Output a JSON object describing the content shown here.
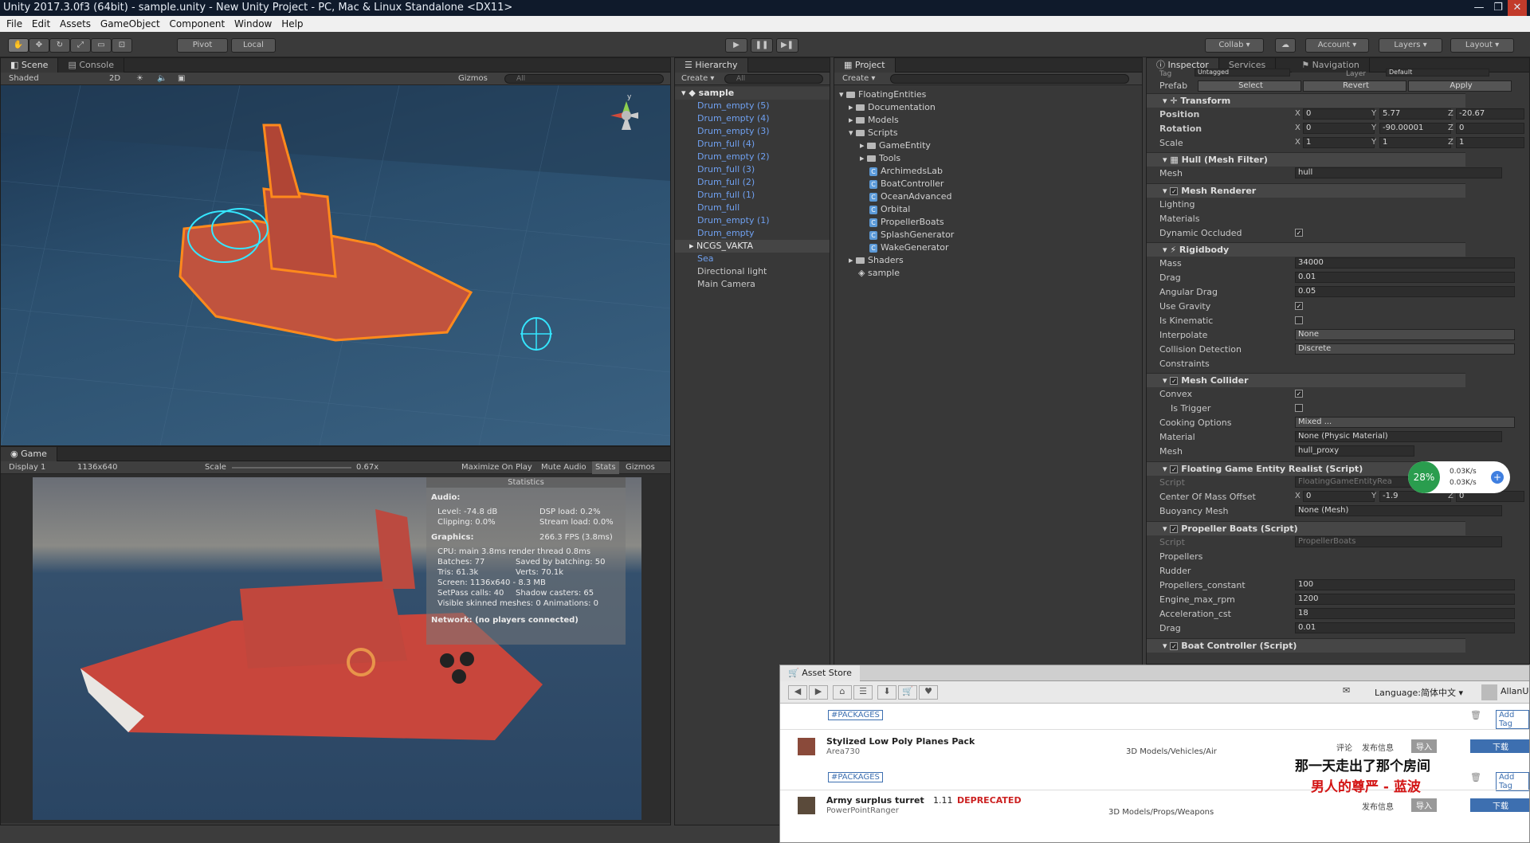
{
  "window": {
    "title": "Unity 2017.3.0f3 (64bit) - sample.unity - New Unity Project - PC, Mac & Linux Standalone <DX11>"
  },
  "menu": [
    "File",
    "Edit",
    "Assets",
    "GameObject",
    "Component",
    "Window",
    "Help"
  ],
  "toolbar": {
    "pivot": "Pivot",
    "local": "Local",
    "collab": "Collab",
    "account": "Account",
    "layers": "Layers",
    "layout": "Layout"
  },
  "scene": {
    "tab": "Scene",
    "console_tab": "Console",
    "shading": "Shaded",
    "mode2d": "2D",
    "gizmos": "Gizmos",
    "search": "All"
  },
  "game": {
    "tab": "Game",
    "display": "Display 1",
    "resolution": "1136x640",
    "scale_label": "Scale",
    "scale_value": "0.67x",
    "maximize": "Maximize On Play",
    "mute": "Mute Audio",
    "stats": "Stats",
    "gizmos": "Gizmos"
  },
  "stats": {
    "title": "Statistics",
    "audio_h": "Audio:",
    "audio_level": "Level: -74.8 dB",
    "dsp": "DSP load: 0.2%",
    "clipping": "Clipping: 0.0%",
    "stream": "Stream load: 0.0%",
    "graphics_h": "Graphics:",
    "fps": "266.3 FPS (3.8ms)",
    "cpu": "CPU: main 3.8ms  render thread 0.8ms",
    "batches": "Batches: 77",
    "saved": "Saved by batching: 50",
    "tris": "Tris: 61.3k",
    "verts": "Verts: 70.1k",
    "screen": "Screen: 1136x640 - 8.3 MB",
    "setpass": "SetPass calls: 40",
    "shadow": "Shadow casters: 65",
    "skinned": "Visible skinned meshes: 0  Animations: 0",
    "network": "Network: (no players connected)"
  },
  "hierarchy": {
    "tab": "Hierarchy",
    "create": "Create",
    "search": "All",
    "scene": "sample",
    "items": [
      "Drum_empty (5)",
      "Drum_empty (4)",
      "Drum_empty (3)",
      "Drum_full (4)",
      "Drum_empty (2)",
      "Drum_full (3)",
      "Drum_full (2)",
      "Drum_full (1)",
      "Drum_full",
      "Drum_empty (1)",
      "Drum_empty"
    ],
    "selected": "NCGS_VAKTA",
    "sea": "Sea",
    "light": "Directional light",
    "camera": "Main Camera"
  },
  "project": {
    "tab": "Project",
    "create": "Create",
    "root": "FloatingEntities",
    "documentation": "Documentation",
    "models": "Models",
    "scripts": "Scripts",
    "gameentity": "GameEntity",
    "tools": "Tools",
    "files": [
      "ArchimedsLab",
      "BoatController",
      "OceanAdvanced",
      "Orbital",
      "PropellerBoats",
      "SplashGenerator",
      "WakeGenerator"
    ],
    "shaders": "Shaders",
    "scene": "sample"
  },
  "inspector": {
    "tab": "Inspector",
    "services": "Services",
    "navigation": "Navigation",
    "tag_label": "Tag",
    "tag_value": "Untagged",
    "layer_label": "Layer",
    "layer_value": "Default",
    "prefab": "Prefab",
    "select": "Select",
    "revert": "Revert",
    "apply": "Apply",
    "transform": "Transform",
    "position": "Position",
    "rotation": "Rotation",
    "scale": "Scale",
    "pos": {
      "x": "0",
      "y": "5.77",
      "z": "-20.67"
    },
    "rot": {
      "x": "0",
      "y": "-90.00001",
      "z": "0"
    },
    "scl": {
      "x": "1",
      "y": "1",
      "z": "1"
    },
    "meshfilter": "Hull (Mesh Filter)",
    "mesh_label": "Mesh",
    "mesh_value": "hull",
    "meshrenderer": "Mesh Renderer",
    "lighting": "Lighting",
    "materials": "Materials",
    "dyn_occ": "Dynamic Occluded",
    "rigidbody": "Rigidbody",
    "mass": "Mass",
    "mass_v": "34000",
    "drag": "Drag",
    "drag_v": "0.01",
    "adrag": "Angular Drag",
    "adrag_v": "0.05",
    "gravity": "Use Gravity",
    "kinematic": "Is Kinematic",
    "interpolate": "Interpolate",
    "interpolate_v": "None",
    "collision": "Collision Detection",
    "collision_v": "Discrete",
    "constraints": "Constraints",
    "meshcollider": "Mesh Collider",
    "convex": "Convex",
    "trigger": "Is Trigger",
    "cooking": "Cooking Options",
    "cooking_v": "Mixed ...",
    "material": "Material",
    "material_v": "None (Physic Material)",
    "mc_mesh": "Mesh",
    "mc_mesh_v": "hull_proxy",
    "floating": "Floating Game Entity Realist (Script)",
    "script": "Script",
    "floating_script": "FloatingGameEntityRea",
    "com": "Center Of Mass Offset",
    "com_x": "0",
    "com_y": "-1.9",
    "com_z": "0",
    "buoy": "Buoyancy Mesh",
    "buoy_v": "None (Mesh)",
    "propeller": "Propeller Boats (Script)",
    "prop_script": "PropellerBoats",
    "propellers": "Propellers",
    "rudder": "Rudder",
    "pconst": "Propellers_constant",
    "pconst_v": "100",
    "rpm": "Engine_max_rpm",
    "rpm_v": "1200",
    "acc": "Acceleration_cst",
    "acc_v": "18",
    "pdrag": "Drag",
    "pdrag_v": "0.01",
    "boatctl": "Boat Controller (Script)"
  },
  "netwidget": {
    "percent": "28%",
    "up": "0.03K/s",
    "down": "0.03K/s"
  },
  "store": {
    "tab": "Asset Store",
    "language": "Language:简体中文",
    "user": "AllanU",
    "tag": "#PACKAGES",
    "item1": {
      "name": "Stylized Low Poly Planes Pack",
      "author": "Area730",
      "cat": "3D Models/Vehicles/Air",
      "review": "评论",
      "release": "发布信息",
      "import": "导入",
      "download": "下载",
      "addtag": "Add Tag"
    },
    "item2": {
      "name": "Army surplus turret",
      "version": "1.11",
      "deprecated": "DEPRECATED",
      "author": "PowerPointRanger",
      "cat": "3D Models/Props/Weapons",
      "release": "发布信息",
      "import": "导入",
      "download": "下载"
    },
    "lyric1": "那一天走出了那个房间",
    "lyric2": "男人的尊严 - 蓝波"
  },
  "colors": {
    "accent": "#3d6fb0",
    "blue_text": "#6fa0f0",
    "orange": "#f07a1a",
    "deprecated": "#cc2222"
  }
}
